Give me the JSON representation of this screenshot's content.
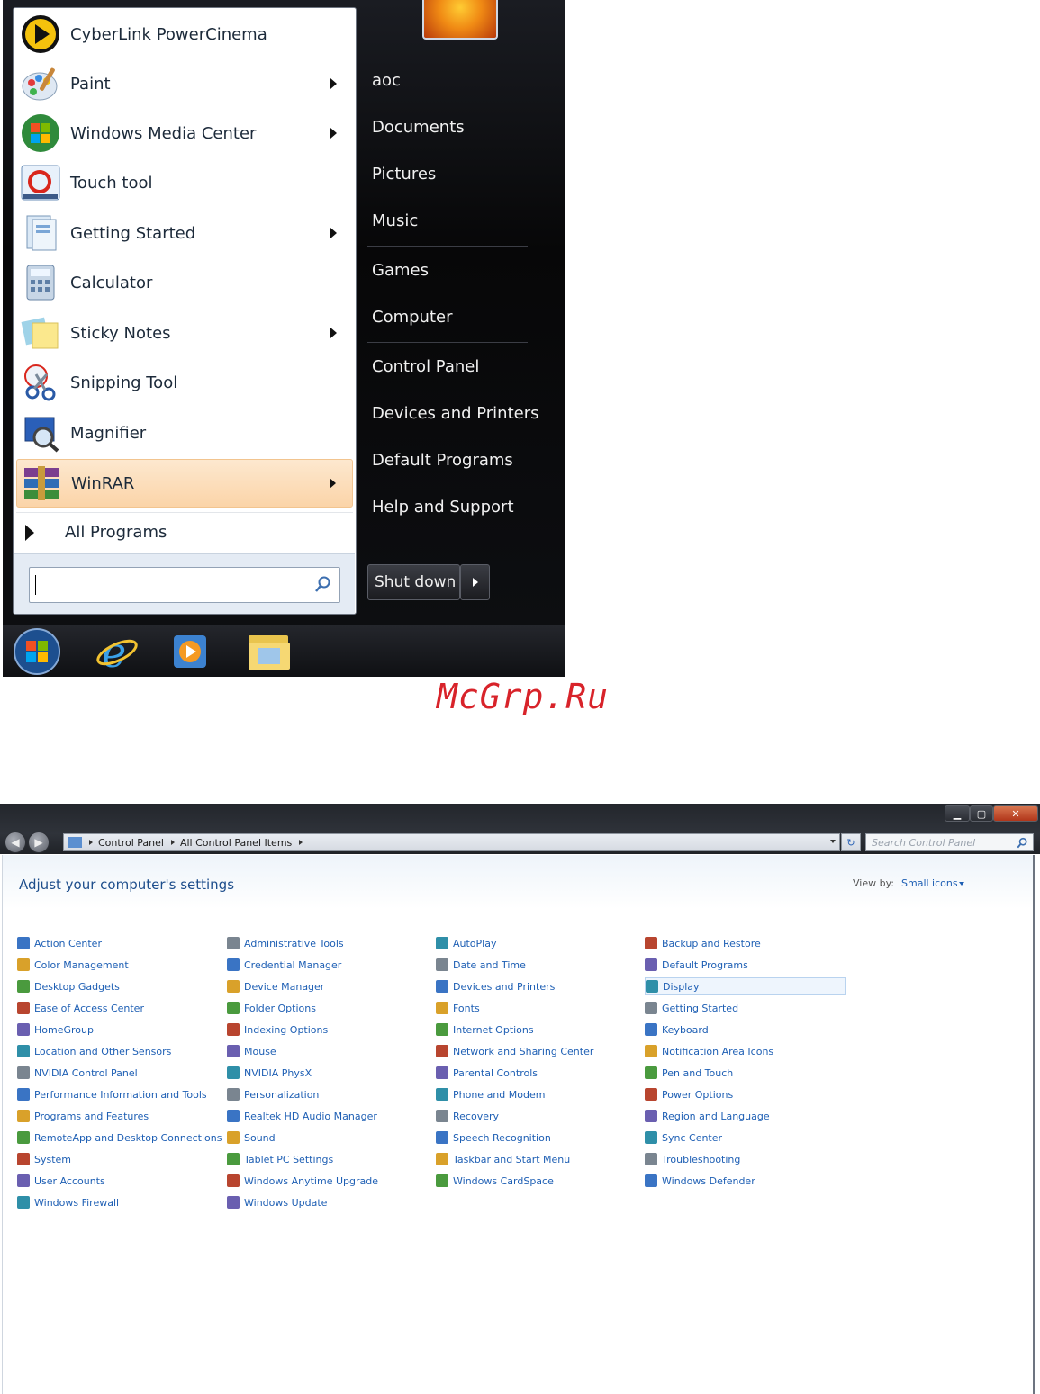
{
  "start_menu": {
    "programs": [
      {
        "label": "CyberLink PowerCinema",
        "icon": "powercinema-icon",
        "submenu": false
      },
      {
        "label": "Paint",
        "icon": "paint-icon",
        "submenu": true
      },
      {
        "label": "Windows Media Center",
        "icon": "media-center-icon",
        "submenu": true
      },
      {
        "label": "Touch tool",
        "icon": "touch-tool-icon",
        "submenu": false
      },
      {
        "label": "Getting Started",
        "icon": "getting-started-icon",
        "submenu": true
      },
      {
        "label": "Calculator",
        "icon": "calculator-icon",
        "submenu": false
      },
      {
        "label": "Sticky Notes",
        "icon": "sticky-notes-icon",
        "submenu": true
      },
      {
        "label": "Snipping Tool",
        "icon": "snipping-tool-icon",
        "submenu": false
      },
      {
        "label": "Magnifier",
        "icon": "magnifier-icon",
        "submenu": false
      },
      {
        "label": "WinRAR",
        "icon": "winrar-icon",
        "submenu": true,
        "highlighted": true
      }
    ],
    "all_programs": "All Programs",
    "search_value": "",
    "right_items": [
      "aoc",
      "Documents",
      "Pictures",
      "Music",
      "Games",
      "Computer",
      "Control Panel",
      "Devices and Printers",
      "Default Programs",
      "Help and Support"
    ],
    "shutdown_label": "Shut down"
  },
  "taskbar": {
    "items": [
      "start-orb-icon",
      "internet-explorer-icon",
      "media-player-icon",
      "windows-explorer-icon"
    ]
  },
  "watermark": "McGrp.Ru",
  "control_panel": {
    "breadcrumb": [
      "Control Panel",
      "All Control Panel Items"
    ],
    "search_placeholder": "Search Control Panel",
    "heading": "Adjust your computer's settings",
    "view_by_label": "View by:",
    "view_by_value": "Small icons",
    "columns": [
      [
        "Action Center",
        "Color Management",
        "Desktop Gadgets",
        "Ease of Access Center",
        "HomeGroup",
        "Location and Other Sensors",
        "NVIDIA Control Panel",
        "Performance Information and Tools",
        "Programs and Features",
        "RemoteApp and Desktop Connections",
        "System",
        "User Accounts",
        "Windows Firewall"
      ],
      [
        "Administrative Tools",
        "Credential Manager",
        "Device Manager",
        "Folder Options",
        "Indexing Options",
        "Mouse",
        "NVIDIA PhysX",
        "Personalization",
        "Realtek HD Audio Manager",
        "Sound",
        "Tablet PC Settings",
        "Windows Anytime Upgrade",
        "Windows Update"
      ],
      [
        "AutoPlay",
        "Date and Time",
        "Devices and Printers",
        "Fonts",
        "Internet Options",
        "Network and Sharing Center",
        "Parental Controls",
        "Phone and Modem",
        "Recovery",
        "Speech Recognition",
        "Taskbar and Start Menu",
        "Windows CardSpace"
      ],
      [
        "Backup and Restore",
        "Default Programs",
        "Display",
        "Getting Started",
        "Keyboard",
        "Notification Area Icons",
        "Pen and Touch",
        "Power Options",
        "Region and Language",
        "Sync Center",
        "Troubleshooting",
        "Windows Defender"
      ]
    ],
    "selected_item": "Display"
  }
}
